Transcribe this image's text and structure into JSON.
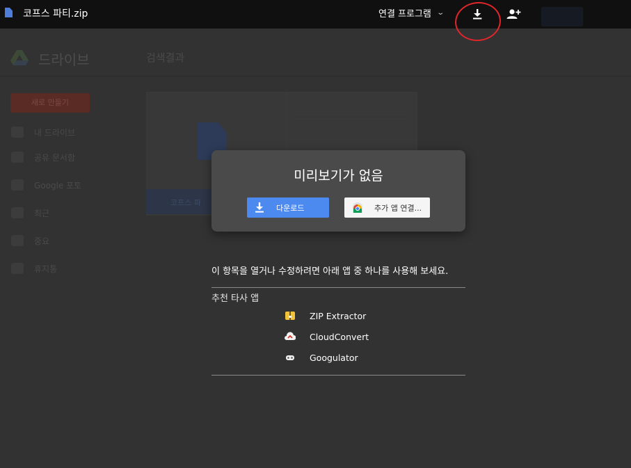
{
  "topbar": {
    "file_title": "코프스 파티.zip",
    "open_with_label": "연결 프로그램",
    "icons": [
      "file-icon",
      "download-icon",
      "add-person-icon",
      "more-vert-icon"
    ]
  },
  "background": {
    "app_name": "드라이브",
    "page_title": "검색결과",
    "new_button": "새로 만들기",
    "sidebar": [
      {
        "label": "내 드라이브"
      },
      {
        "label": "공유 문서함"
      },
      {
        "label": "Google 포토"
      },
      {
        "label": "최근"
      },
      {
        "label": "중요"
      },
      {
        "label": "휴지통"
      }
    ],
    "card_label": "코프스 파"
  },
  "dialog": {
    "title": "미리보기가 없음",
    "download_label": "다운로드",
    "more_apps_label": "추가 앱 연결..."
  },
  "info": {
    "message": "이 항목을 열거나 수정하려면 아래 앱 중 하나를 사용해 보세요.",
    "recommended_label": "추천 타사 앱",
    "apps": [
      {
        "name": "ZIP Extractor",
        "icon": "zip-extractor-icon"
      },
      {
        "name": "CloudConvert",
        "icon": "cloudconvert-icon"
      },
      {
        "name": "Googulator",
        "icon": "googulator-icon"
      }
    ]
  },
  "colors": {
    "topbar": "#101010",
    "dialog": "#4b4a4b",
    "download_button": "#4d8af0",
    "annotation": "#e0262a"
  }
}
